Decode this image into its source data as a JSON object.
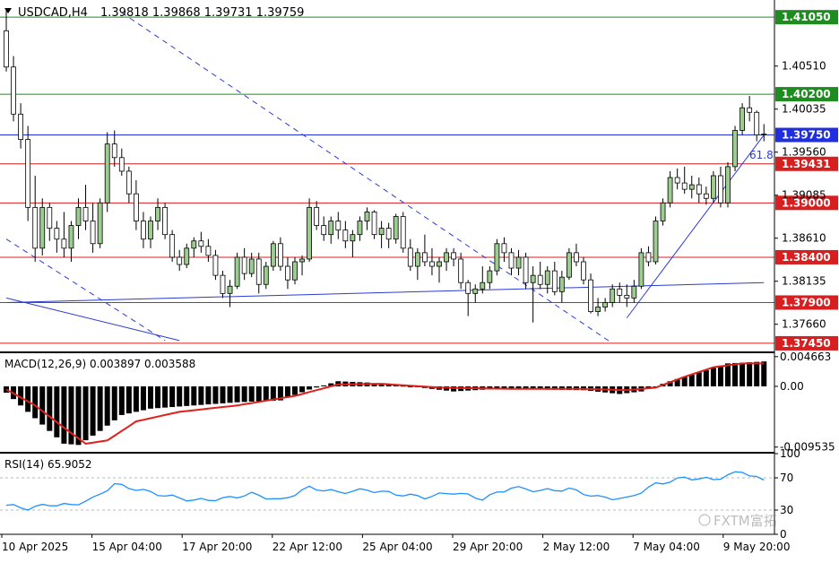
{
  "chart_data": {
    "type": "candlestick",
    "symbol": "USDCAD",
    "timeframe": "H4",
    "header": {
      "symbol_tf": "USDCAD,H4",
      "ohlc": "1.39818  1.39868  1.39731  1.39759"
    },
    "price_axis": {
      "range": [
        1.3738,
        1.4122
      ],
      "ticks": [
        "1.40510",
        "1.40035",
        "1.39560",
        "1.39085",
        "1.38610",
        "1.38135",
        "1.37660"
      ]
    },
    "time_axis_labels": [
      "10 Apr 2025",
      "15 Apr 04:00",
      "17 Apr 20:00",
      "22 Apr 12:00",
      "25 Apr 04:00",
      "29 Apr 20:00",
      "2 May 12:00",
      "7 May 04:00",
      "9 May 20:00"
    ],
    "horizontal_levels": [
      {
        "price": 1.4105,
        "label": "1.41050",
        "color": "#1e8c1e"
      },
      {
        "price": 1.402,
        "label": "1.40200",
        "color": "#1e8c1e"
      },
      {
        "price": 1.3975,
        "label": "1.39750",
        "color": "#1f2fe0"
      },
      {
        "price": 1.39431,
        "label": "1.39431",
        "color": "#d81f1f"
      },
      {
        "price": 1.39,
        "label": "1.39000",
        "color": "#d81f1f"
      },
      {
        "price": 1.384,
        "label": "1.38400",
        "color": "#d81f1f"
      },
      {
        "price": 1.379,
        "label": "1.37900",
        "color": "#d81f1f"
      },
      {
        "price": 1.3745,
        "label": "1.37450",
        "color": "#d81f1f"
      }
    ],
    "fib_label": "61.8",
    "candles": [
      [
        1.409,
        1.4115,
        1.4045,
        1.405
      ],
      [
        1.405,
        1.4062,
        1.399,
        1.3998
      ],
      [
        1.3998,
        1.401,
        1.396,
        1.397
      ],
      [
        1.397,
        1.3985,
        1.388,
        1.3895
      ],
      [
        1.3895,
        1.393,
        1.3835,
        1.385
      ],
      [
        1.385,
        1.3905,
        1.3842,
        1.3895
      ],
      [
        1.3895,
        1.39,
        1.3858,
        1.3872
      ],
      [
        1.3872,
        1.388,
        1.3845,
        1.386
      ],
      [
        1.386,
        1.389,
        1.384,
        1.385
      ],
      [
        1.385,
        1.388,
        1.3835,
        1.3875
      ],
      [
        1.3875,
        1.3905,
        1.386,
        1.3895
      ],
      [
        1.3895,
        1.392,
        1.387,
        1.388
      ],
      [
        1.388,
        1.39,
        1.3845,
        1.3855
      ],
      [
        1.3855,
        1.3905,
        1.385,
        1.39
      ],
      [
        1.39,
        1.3978,
        1.389,
        1.3965
      ],
      [
        1.3965,
        1.398,
        1.394,
        1.395
      ],
      [
        1.395,
        1.396,
        1.393,
        1.3935
      ],
      [
        1.3935,
        1.394,
        1.39,
        1.391
      ],
      [
        1.391,
        1.3925,
        1.387,
        1.388
      ],
      [
        1.388,
        1.389,
        1.385,
        1.386
      ],
      [
        1.386,
        1.3885,
        1.385,
        1.388
      ],
      [
        1.388,
        1.3905,
        1.387,
        1.3895
      ],
      [
        1.3895,
        1.39,
        1.386,
        1.3865
      ],
      [
        1.3865,
        1.387,
        1.3835,
        1.384
      ],
      [
        1.384,
        1.3848,
        1.3825,
        1.3832
      ],
      [
        1.3832,
        1.3855,
        1.3828,
        1.385
      ],
      [
        1.385,
        1.3862,
        1.384,
        1.3858
      ],
      [
        1.3858,
        1.3868,
        1.3845,
        1.3852
      ],
      [
        1.3852,
        1.386,
        1.3835,
        1.3842
      ],
      [
        1.3842,
        1.3848,
        1.3815,
        1.382
      ],
      [
        1.382,
        1.3825,
        1.3795,
        1.38
      ],
      [
        1.38,
        1.3815,
        1.3785,
        1.3808
      ],
      [
        1.3808,
        1.3845,
        1.3805,
        1.384
      ],
      [
        1.384,
        1.385,
        1.3815,
        1.3822
      ],
      [
        1.3822,
        1.3845,
        1.3818,
        1.3838
      ],
      [
        1.3838,
        1.3845,
        1.38,
        1.381
      ],
      [
        1.381,
        1.3835,
        1.3805,
        1.383
      ],
      [
        1.383,
        1.3858,
        1.3825,
        1.3855
      ],
      [
        1.3855,
        1.3862,
        1.3825,
        1.383
      ],
      [
        1.383,
        1.384,
        1.3805,
        1.3815
      ],
      [
        1.3815,
        1.384,
        1.381,
        1.3835
      ],
      [
        1.3835,
        1.3842,
        1.382,
        1.3838
      ],
      [
        1.3838,
        1.3905,
        1.3835,
        1.3895
      ],
      [
        1.3895,
        1.3902,
        1.387,
        1.3875
      ],
      [
        1.3875,
        1.3885,
        1.3858,
        1.3865
      ],
      [
        1.3865,
        1.3885,
        1.3855,
        1.388
      ],
      [
        1.388,
        1.389,
        1.386,
        1.387
      ],
      [
        1.387,
        1.388,
        1.385,
        1.3858
      ],
      [
        1.3858,
        1.387,
        1.384,
        1.3865
      ],
      [
        1.3865,
        1.3885,
        1.3858,
        1.388
      ],
      [
        1.388,
        1.3895,
        1.387,
        1.389
      ],
      [
        1.389,
        1.3892,
        1.386,
        1.3865
      ],
      [
        1.3865,
        1.388,
        1.385,
        1.3872
      ],
      [
        1.3872,
        1.3878,
        1.385,
        1.386
      ],
      [
        1.386,
        1.3888,
        1.3855,
        1.3885
      ],
      [
        1.3885,
        1.389,
        1.3845,
        1.385
      ],
      [
        1.385,
        1.386,
        1.3825,
        1.383
      ],
      [
        1.383,
        1.385,
        1.3815,
        1.3845
      ],
      [
        1.3845,
        1.3865,
        1.383,
        1.3835
      ],
      [
        1.3835,
        1.385,
        1.382,
        1.383
      ],
      [
        1.383,
        1.384,
        1.3812,
        1.3835
      ],
      [
        1.3835,
        1.385,
        1.3825,
        1.3845
      ],
      [
        1.3845,
        1.385,
        1.383,
        1.3838
      ],
      [
        1.3838,
        1.3845,
        1.3805,
        1.3812
      ],
      [
        1.3812,
        1.3815,
        1.3775,
        1.38
      ],
      [
        1.38,
        1.381,
        1.379,
        1.3805
      ],
      [
        1.3805,
        1.383,
        1.38,
        1.3812
      ],
      [
        1.3812,
        1.383,
        1.3805,
        1.3825
      ],
      [
        1.3825,
        1.386,
        1.382,
        1.3855
      ],
      [
        1.3855,
        1.3862,
        1.3835,
        1.3845
      ],
      [
        1.3845,
        1.385,
        1.382,
        1.3828
      ],
      [
        1.3828,
        1.3848,
        1.382,
        1.384
      ],
      [
        1.384,
        1.3845,
        1.3805,
        1.3812
      ],
      [
        1.3812,
        1.383,
        1.3768,
        1.382
      ],
      [
        1.382,
        1.3835,
        1.3805,
        1.381
      ],
      [
        1.381,
        1.383,
        1.38,
        1.3825
      ],
      [
        1.3825,
        1.3835,
        1.3798,
        1.3802
      ],
      [
        1.3802,
        1.3825,
        1.379,
        1.3818
      ],
      [
        1.3818,
        1.385,
        1.3815,
        1.3845
      ],
      [
        1.3845,
        1.3855,
        1.383,
        1.3835
      ],
      [
        1.3835,
        1.384,
        1.381,
        1.3815
      ],
      [
        1.3815,
        1.3822,
        1.3778,
        1.378
      ],
      [
        1.378,
        1.3795,
        1.3775,
        1.3785
      ],
      [
        1.3785,
        1.3795,
        1.378,
        1.379
      ],
      [
        1.379,
        1.381,
        1.3785,
        1.3805
      ],
      [
        1.3805,
        1.3812,
        1.379,
        1.3798
      ],
      [
        1.3798,
        1.381,
        1.3785,
        1.3795
      ],
      [
        1.3795,
        1.3815,
        1.379,
        1.3808
      ],
      [
        1.3808,
        1.385,
        1.3805,
        1.3845
      ],
      [
        1.3845,
        1.3852,
        1.383,
        1.3835
      ],
      [
        1.3835,
        1.3885,
        1.3832,
        1.388
      ],
      [
        1.388,
        1.3905,
        1.3875,
        1.39
      ],
      [
        1.39,
        1.3935,
        1.3895,
        1.3928
      ],
      [
        1.3928,
        1.3938,
        1.3915,
        1.3922
      ],
      [
        1.3922,
        1.394,
        1.391,
        1.3915
      ],
      [
        1.3915,
        1.393,
        1.3905,
        1.392
      ],
      [
        1.392,
        1.3928,
        1.39,
        1.391
      ],
      [
        1.391,
        1.3918,
        1.3898,
        1.3905
      ],
      [
        1.3905,
        1.3935,
        1.39,
        1.393
      ],
      [
        1.393,
        1.394,
        1.3895,
        1.39
      ],
      [
        1.39,
        1.3945,
        1.3895,
        1.394
      ],
      [
        1.394,
        1.3985,
        1.3935,
        1.398
      ],
      [
        1.398,
        1.401,
        1.3975,
        1.4005
      ],
      [
        1.4005,
        1.4018,
        1.399,
        1.4
      ],
      [
        1.4,
        1.4002,
        1.3968,
        1.3975
      ],
      [
        1.3975,
        1.3987,
        1.3968,
        1.3976
      ]
    ],
    "trendlines": [
      {
        "name": "dashed downtrend",
        "style": "dash",
        "from": [
          16,
          1.411
        ],
        "to": [
          84,
          1.3745
        ]
      },
      {
        "name": "lower dashed channel",
        "style": "dash",
        "from": [
          0,
          1.386
        ],
        "to": [
          22,
          1.3748
        ]
      },
      {
        "name": "ascending blue support",
        "style": "solid",
        "from": [
          0,
          1.379
        ],
        "to": [
          105,
          1.3812
        ]
      },
      {
        "name": "falling blue line",
        "style": "solid",
        "from": [
          0,
          1.3795
        ],
        "to": [
          24,
          1.3748
        ]
      },
      {
        "name": "rising blue uptrend",
        "style": "solid",
        "from": [
          86,
          1.3773
        ],
        "to": [
          105,
          1.3975
        ]
      }
    ],
    "macd": {
      "label": "MACD(12,26,9) 0.003897 0.003588",
      "ticks": [
        "0.004663",
        "0.00",
        "-0.009535"
      ],
      "range": [
        -0.01,
        0.0052
      ],
      "histogram_keypoints": [
        [
          0,
          -0.001
        ],
        [
          4,
          -0.005
        ],
        [
          8,
          -0.009
        ],
        [
          10,
          -0.0092
        ],
        [
          13,
          -0.007
        ],
        [
          16,
          -0.0045
        ],
        [
          20,
          -0.0035
        ],
        [
          26,
          -0.003
        ],
        [
          32,
          -0.0025
        ],
        [
          38,
          -0.0022
        ],
        [
          42,
          -0.0005
        ],
        [
          46,
          0.0008
        ],
        [
          50,
          0.0006
        ],
        [
          56,
          0.0
        ],
        [
          62,
          -0.0008
        ],
        [
          68,
          -0.0004
        ],
        [
          74,
          -0.0005
        ],
        [
          80,
          -0.0006
        ],
        [
          85,
          -0.0012
        ],
        [
          88,
          -0.0008
        ],
        [
          92,
          0.0008
        ],
        [
          96,
          0.0022
        ],
        [
          100,
          0.0036
        ],
        [
          105,
          0.0039
        ]
      ],
      "signal_keypoints": [
        [
          0,
          -0.0005
        ],
        [
          4,
          -0.003
        ],
        [
          8,
          -0.0065
        ],
        [
          11,
          -0.009
        ],
        [
          14,
          -0.0085
        ],
        [
          18,
          -0.0055
        ],
        [
          24,
          -0.004
        ],
        [
          32,
          -0.003
        ],
        [
          40,
          -0.0015
        ],
        [
          46,
          0.0003
        ],
        [
          52,
          0.0004
        ],
        [
          60,
          -0.0002
        ],
        [
          70,
          -0.0004
        ],
        [
          80,
          -0.0004
        ],
        [
          86,
          -0.0006
        ],
        [
          90,
          -0.0002
        ],
        [
          94,
          0.0015
        ],
        [
          98,
          0.003
        ],
        [
          102,
          0.0036
        ],
        [
          105,
          0.0036
        ]
      ]
    },
    "rsi": {
      "label": "RSI(14) 65.9052",
      "ticks": [
        "100",
        "70",
        "30",
        "0"
      ],
      "levels": [
        70,
        30
      ],
      "keypoints": [
        [
          0,
          36
        ],
        [
          3,
          32
        ],
        [
          6,
          37
        ],
        [
          9,
          36
        ],
        [
          12,
          44
        ],
        [
          15,
          62
        ],
        [
          18,
          56
        ],
        [
          22,
          48
        ],
        [
          26,
          42
        ],
        [
          30,
          44
        ],
        [
          34,
          50
        ],
        [
          38,
          42
        ],
        [
          42,
          58
        ],
        [
          46,
          52
        ],
        [
          50,
          55
        ],
        [
          54,
          50
        ],
        [
          58,
          46
        ],
        [
          62,
          52
        ],
        [
          66,
          44
        ],
        [
          70,
          58
        ],
        [
          74,
          54
        ],
        [
          78,
          56
        ],
        [
          82,
          46
        ],
        [
          86,
          44
        ],
        [
          90,
          62
        ],
        [
          94,
          70
        ],
        [
          98,
          68
        ],
        [
          102,
          78
        ],
        [
          105,
          66
        ]
      ]
    }
  },
  "watermark": {
    "text": "FXTM富拓"
  }
}
